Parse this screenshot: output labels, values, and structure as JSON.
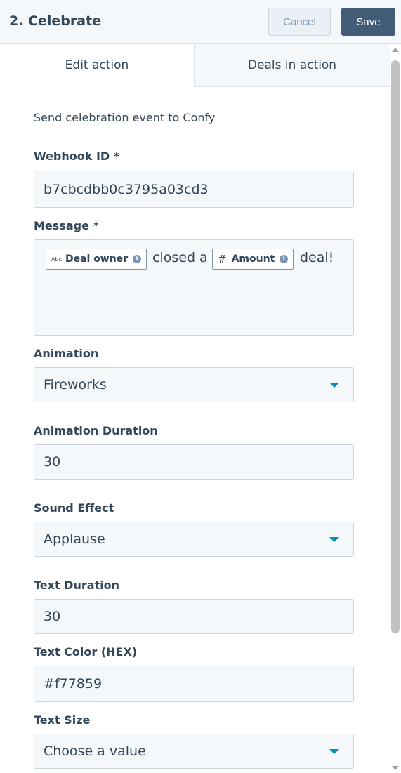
{
  "header": {
    "title": "2. Celebrate",
    "cancel_label": "Cancel",
    "save_label": "Save"
  },
  "tabs": [
    {
      "label": "Edit action",
      "active": true
    },
    {
      "label": "Deals in action",
      "active": false
    }
  ],
  "form": {
    "description": "Send celebration event to Confy",
    "webhook": {
      "label": "Webhook ID *",
      "value": "b7cbcdbb0c3795a03cd3"
    },
    "message": {
      "label": "Message *",
      "token1": {
        "type_icon": "Abc",
        "label": "Deal owner",
        "icon": "info-icon"
      },
      "text1": "closed a",
      "token2": {
        "type_icon": "#",
        "label": "Amount",
        "icon": "info-icon"
      },
      "text2": "deal!"
    },
    "animation": {
      "label": "Animation",
      "value": "Fireworks"
    },
    "animation_duration": {
      "label": "Animation Duration",
      "value": "30"
    },
    "sound_effect": {
      "label": "Sound Effect",
      "value": "Applause"
    },
    "text_duration": {
      "label": "Text Duration",
      "value": "30"
    },
    "text_color": {
      "label": "Text Color (HEX)",
      "value": "#f77859"
    },
    "text_size": {
      "label": "Text Size",
      "value": "Choose a value"
    }
  },
  "colors": {
    "primary_text": "#33475b",
    "save_button": "#425b76",
    "field_bg": "#f5f8fa",
    "dropdown_caret": "#0091ae"
  }
}
